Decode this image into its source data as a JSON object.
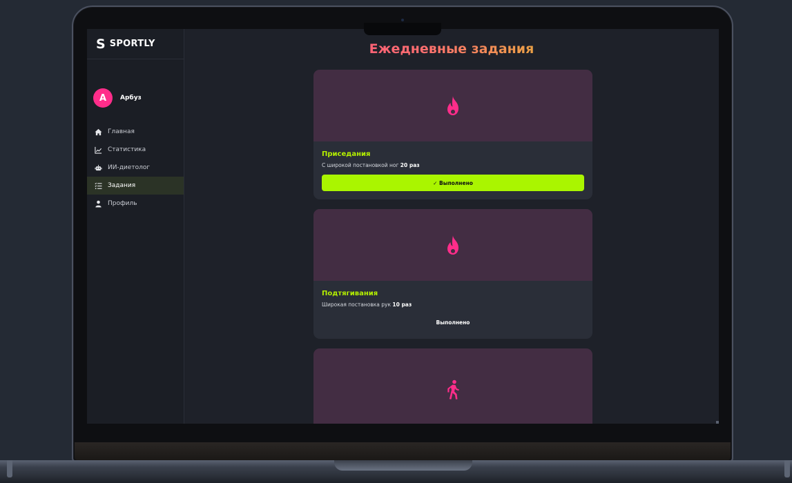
{
  "app": {
    "logo_letter": "S",
    "logo_text": "SPORTLY",
    "brand_colors": {
      "accent_pink": "#ff2d8a",
      "accent_lime": "#aaf500"
    }
  },
  "user": {
    "avatar_initial": "А",
    "name": "Арбуз"
  },
  "sidebar": {
    "items": [
      {
        "label": "Главная",
        "icon": "home-icon"
      },
      {
        "label": "Статистика",
        "icon": "chart-line-icon"
      },
      {
        "label": "ИИ-диетолог",
        "icon": "robot-icon"
      },
      {
        "label": "Задания",
        "icon": "task-list-icon",
        "active": true
      },
      {
        "label": "Профиль",
        "icon": "user-icon"
      }
    ]
  },
  "page": {
    "title": "Ежедневные задания"
  },
  "tasks": [
    {
      "icon": "fire-icon",
      "title": "Приседания",
      "desc_prefix": "С широкой постановкой ног",
      "desc_amount": "20 раз",
      "button_label": "✓ Выполнено",
      "completed": true
    },
    {
      "icon": "fire-icon",
      "title": "Подтягивания",
      "desc_prefix": "Широкая постановка рук",
      "desc_amount": "10 раз",
      "button_label": "Выполнено",
      "completed": false
    },
    {
      "icon": "walking-icon"
    }
  ]
}
